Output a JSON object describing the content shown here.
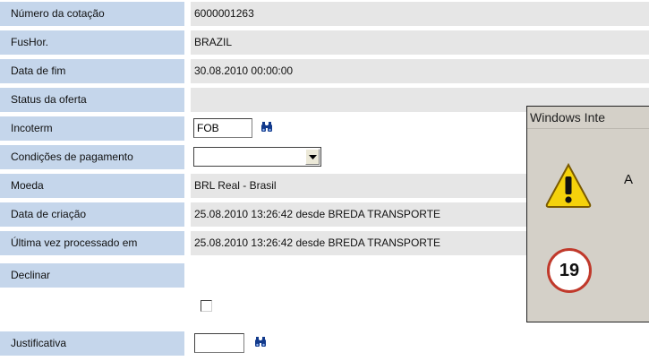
{
  "form": {
    "quotation_number": {
      "label": "Número da cotação",
      "value": "6000001263"
    },
    "timezone": {
      "label": "FusHor.",
      "value": "BRAZIL"
    },
    "end_date": {
      "label": "Data de fim",
      "value": "30.08.2010  00:00:00"
    },
    "offer_status": {
      "label": "Status da oferta",
      "value": ""
    },
    "incoterm": {
      "label": "Incoterm",
      "value": "FOB"
    },
    "payment_terms": {
      "label": "Condições de pagamento",
      "value": ""
    },
    "currency": {
      "label": "Moeda",
      "value": "BRL  Real - Brasil"
    },
    "created_on": {
      "label": "Data de criação",
      "value": "25.08.2010 13:26:42  desde  BREDA TRANSPORTE"
    },
    "last_processed": {
      "label": "Última vez processado em",
      "value": "25.08.2010 13:26:42  desde  BREDA TRANSPORTE"
    },
    "decline": {
      "label": "Declinar",
      "checked": false
    },
    "justification": {
      "label": "Justificativa",
      "value": ""
    }
  },
  "dialog": {
    "title": "Windows Inte",
    "message": "A"
  },
  "step_badge": "19",
  "colors": {
    "label_bg": "#c5d6eb",
    "value_bg": "#e6e6e6",
    "badge_border": "#c0392b",
    "warning_yellow": "#f5d20b"
  },
  "icons": {
    "search": "binoculars-icon",
    "warning": "warning-icon",
    "dropdown": "chevron-down-icon"
  }
}
